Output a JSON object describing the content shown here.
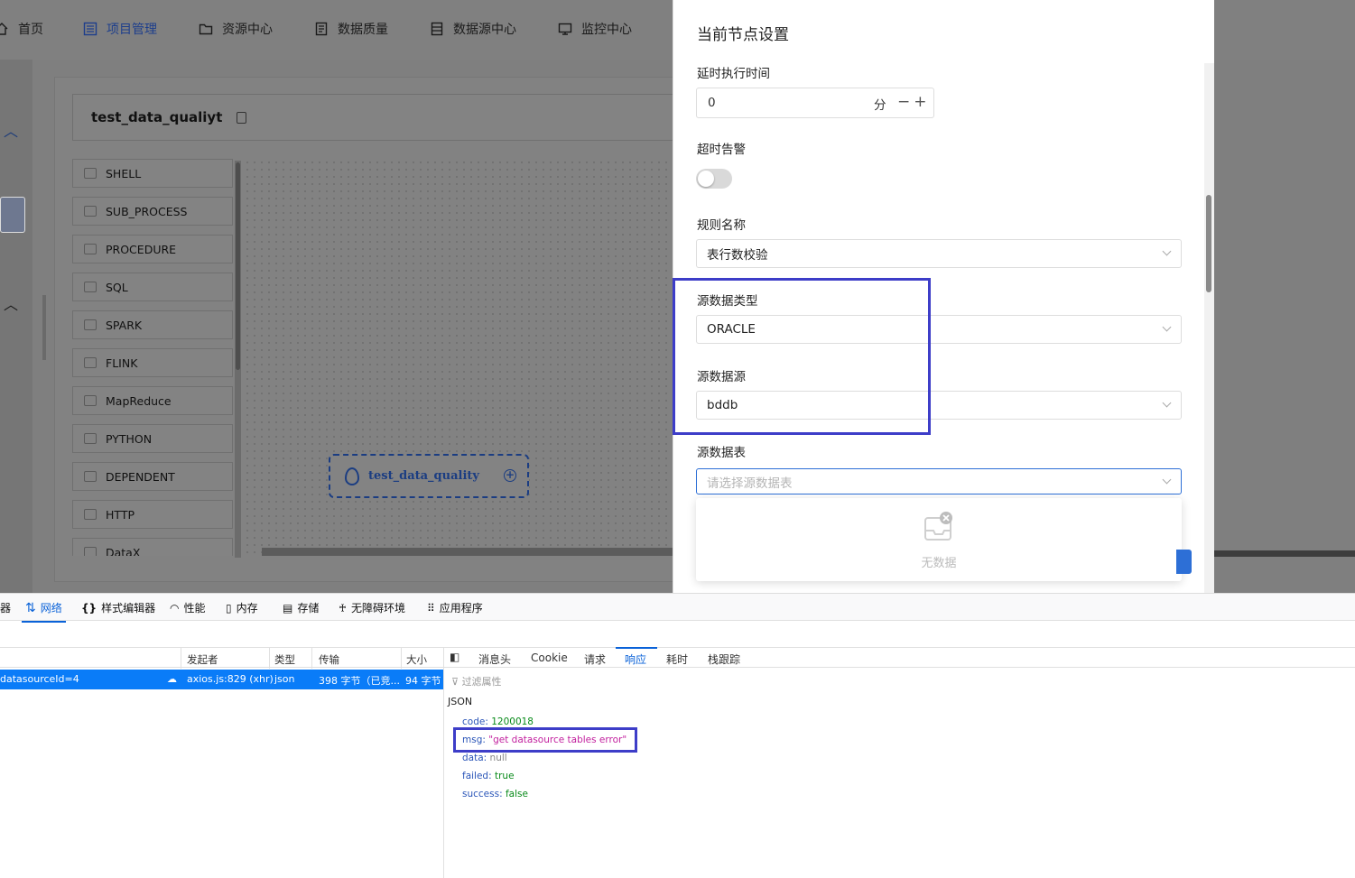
{
  "nav": {
    "items": [
      {
        "label": "首页",
        "icon": "home-icon"
      },
      {
        "label": "项目管理",
        "icon": "project-icon",
        "active": true
      },
      {
        "label": "资源中心",
        "icon": "folder-icon"
      },
      {
        "label": "数据质量",
        "icon": "document-icon"
      },
      {
        "label": "数据源中心",
        "icon": "database-icon"
      },
      {
        "label": "监控中心",
        "icon": "monitor-icon"
      }
    ]
  },
  "workflow": {
    "name": "test_data_qualiyt"
  },
  "palette": {
    "items": [
      "SHELL",
      "SUB_PROCESS",
      "PROCEDURE",
      "SQL",
      "SPARK",
      "FLINK",
      "MapReduce",
      "PYTHON",
      "DEPENDENT",
      "HTTP",
      "DataX"
    ]
  },
  "canvas": {
    "node_label": "test_data_quality"
  },
  "drawer": {
    "title": "当前节点设置",
    "delay_label": "延时执行时间",
    "delay_value": "0",
    "delay_unit": "分",
    "delay_stepper": "−+",
    "timeout_label": "超时告警",
    "timeout_enabled": false,
    "rule_label": "规则名称",
    "rule_value": "表行数校验",
    "src_type_label": "源数据类型",
    "src_type_value": "ORACLE",
    "src_ds_label": "源数据源",
    "src_ds_value": "bddb",
    "src_table_label": "源数据表",
    "src_table_placeholder": "请选择源数据表",
    "empty_text": "无数据"
  },
  "devtools": {
    "tabs": [
      {
        "label": "器",
        "icon": ""
      },
      {
        "label": "网络",
        "icon": "network-arrows-icon",
        "active": true
      },
      {
        "label": "样式编辑器",
        "icon": "braces-icon"
      },
      {
        "label": "性能",
        "icon": "gauge-icon"
      },
      {
        "label": "内存",
        "icon": "chip-icon"
      },
      {
        "label": "存储",
        "icon": "storage-icon"
      },
      {
        "label": "无障碍环境",
        "icon": "accessibility-icon"
      },
      {
        "label": "应用程序",
        "icon": "grid-icon"
      }
    ],
    "columns": [
      "发起者",
      "类型",
      "传输",
      "大小"
    ],
    "request": {
      "url": "datasourceId=4",
      "initiator": "axios.js:829 (xhr)",
      "type": "json",
      "transfer": "398 字节（已竞...",
      "size": "94 字节"
    },
    "detail_tabs": [
      "消息头",
      "Cookie",
      "请求",
      "响应",
      "耗时",
      "栈跟踪"
    ],
    "active_detail_tab": "响应",
    "filter_placeholder": "过滤属性",
    "json_label": "JSON",
    "json": [
      {
        "key": "code",
        "value": "1200018",
        "kind": "num"
      },
      {
        "key": "msg",
        "value": "\"get datasource tables error\"",
        "kind": "str"
      },
      {
        "key": "data",
        "value": "null",
        "kind": "null"
      },
      {
        "key": "failed",
        "value": "true",
        "kind": "num"
      },
      {
        "key": "success",
        "value": "false",
        "kind": "num"
      }
    ]
  },
  "colors": {
    "accent": "#2d6fd6",
    "highlight": "#3d3dc8",
    "devtools_active": "#0a62d8"
  }
}
